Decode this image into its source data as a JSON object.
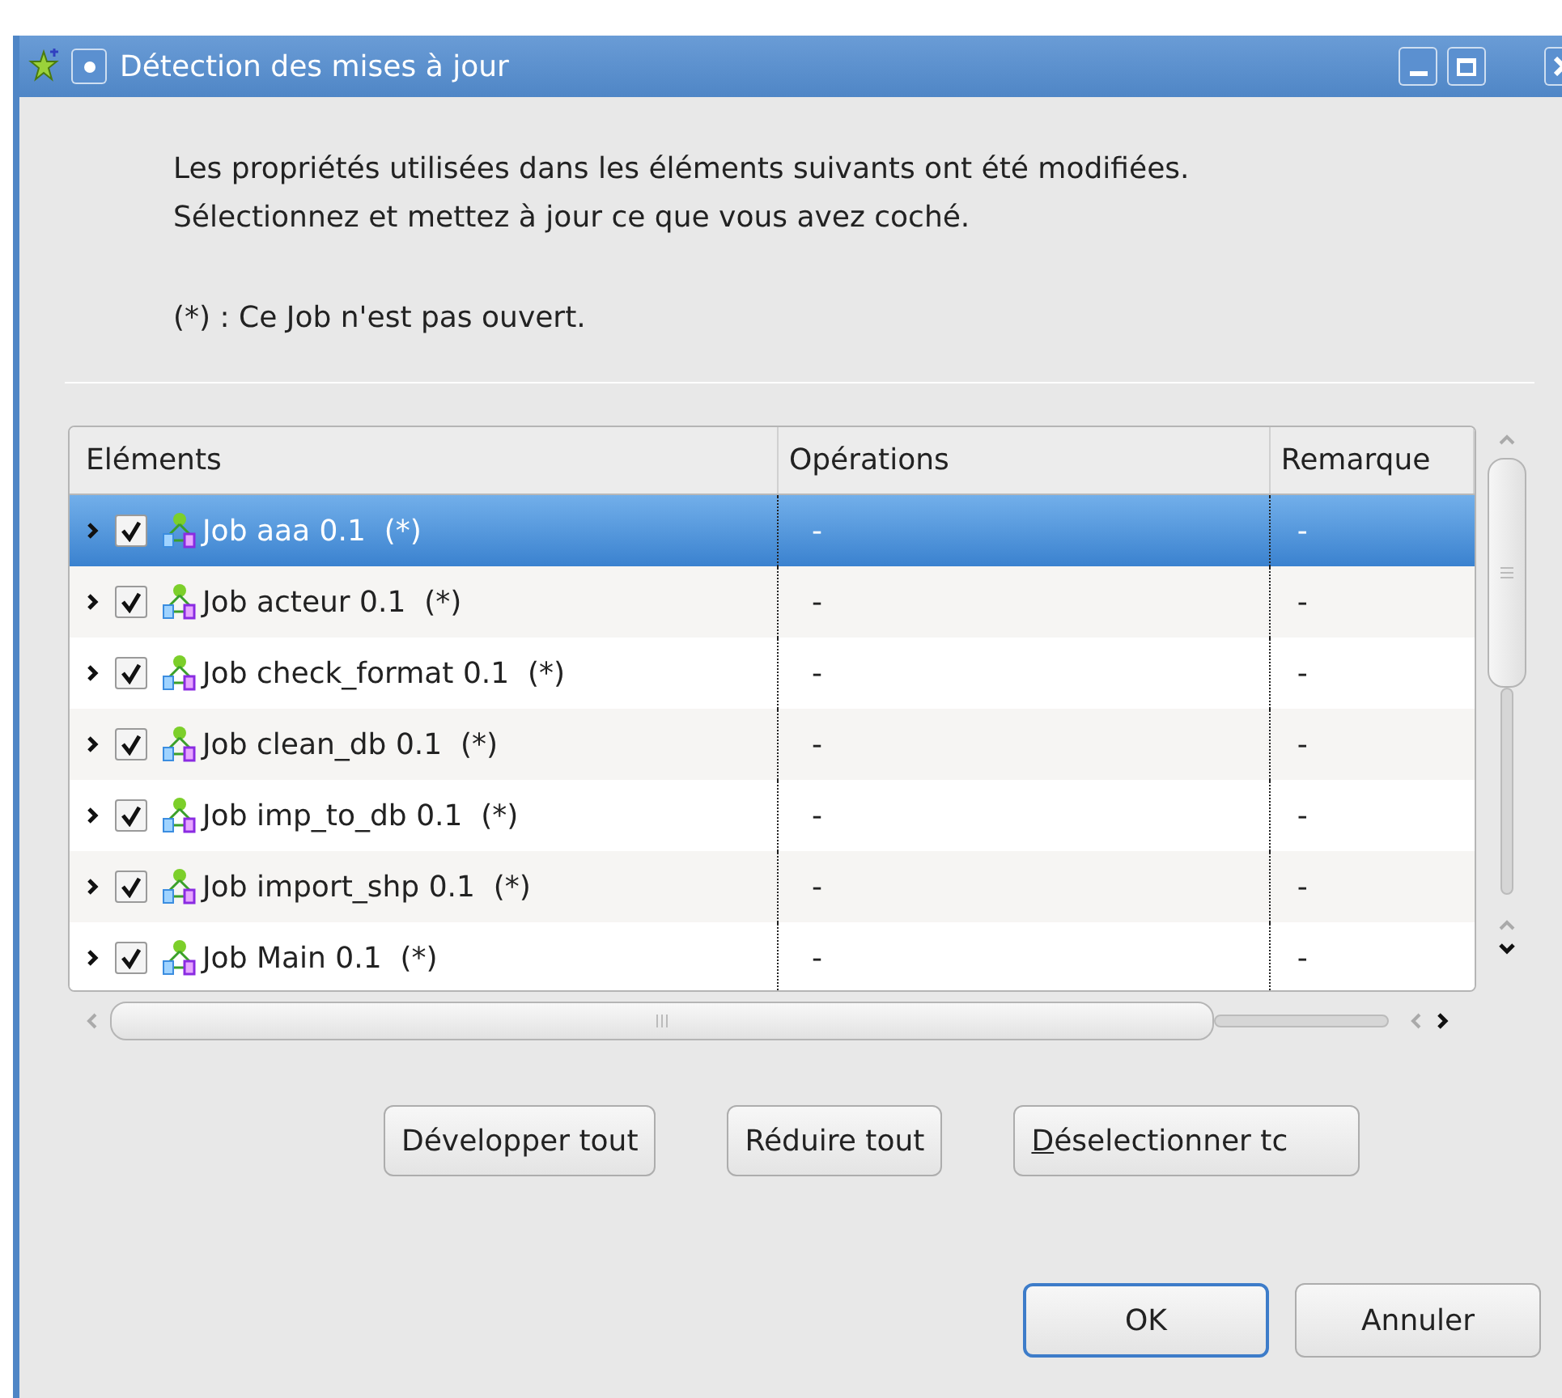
{
  "window": {
    "title": "Détection des mises à jour"
  },
  "message": [
    "Les propriétés utilisées dans les éléments suivants ont été modifiées.",
    "Sélectionnez et mettez à jour ce que vous avez coché."
  ],
  "note": "(*) : Ce Job n'est pas ouvert.",
  "table": {
    "columns": [
      "Eléments",
      "Opérations",
      "Remarque"
    ],
    "rows": [
      {
        "name": "Job aaa 0.1  (*)",
        "operations": "-",
        "remark": "-",
        "checked": true,
        "expanded": false,
        "selected": true
      },
      {
        "name": "Job acteur 0.1  (*)",
        "operations": "-",
        "remark": "-",
        "checked": true,
        "expanded": false,
        "selected": false
      },
      {
        "name": "Job check_format 0.1  (*)",
        "operations": "-",
        "remark": "-",
        "checked": true,
        "expanded": false,
        "selected": false
      },
      {
        "name": "Job clean_db 0.1  (*)",
        "operations": "-",
        "remark": "-",
        "checked": true,
        "expanded": false,
        "selected": false
      },
      {
        "name": "Job imp_to_db 0.1  (*)",
        "operations": "-",
        "remark": "-",
        "checked": true,
        "expanded": false,
        "selected": false
      },
      {
        "name": "Job import_shp 0.1  (*)",
        "operations": "-",
        "remark": "-",
        "checked": true,
        "expanded": false,
        "selected": false
      },
      {
        "name": "Job Main 0.1  (*)",
        "operations": "-",
        "remark": "-",
        "checked": true,
        "expanded": false,
        "selected": false
      }
    ]
  },
  "tree_buttons": [
    {
      "label": "Développer tout",
      "underline_first": false
    },
    {
      "label": "Réduire tout",
      "underline_first": false
    },
    {
      "label": "Déselectionner tc",
      "underline_first": true
    }
  ],
  "dialog_buttons": [
    {
      "label": "OK",
      "default": true
    },
    {
      "label": "Annuler",
      "default": false
    }
  ]
}
